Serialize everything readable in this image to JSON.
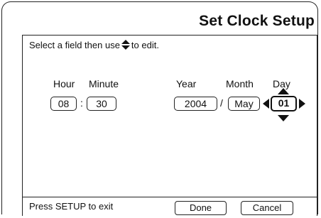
{
  "title": "Set Clock Setup",
  "instruction": {
    "prefix": "Select a field then use",
    "icon": "up-down-arrow-icon",
    "suffix": "to edit."
  },
  "time": {
    "hour_label": "Hour",
    "minute_label": "Minute",
    "hour_value": "08",
    "separator": ":",
    "minute_value": "30"
  },
  "date": {
    "year_label": "Year",
    "month_label": "Month",
    "day_label": "Day",
    "year_value": "2004",
    "separator": "/",
    "month_value": "May",
    "day_value": "01",
    "selected_field": "Day"
  },
  "status": {
    "hint": "Press SETUP to exit",
    "done_label": "Done",
    "cancel_label": "Cancel"
  }
}
